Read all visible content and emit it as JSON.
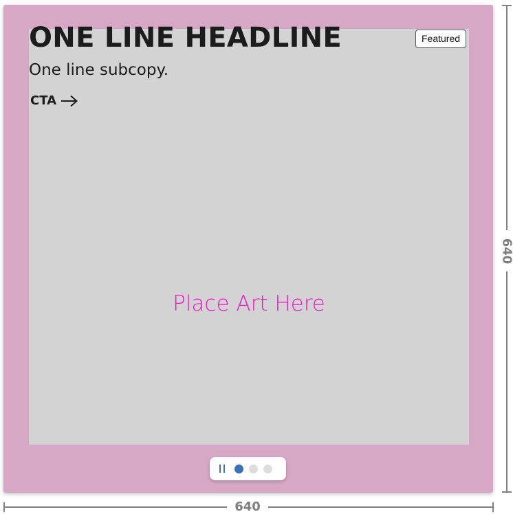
{
  "card": {
    "headline": "ONE LINE HEADLINE",
    "subcopy": "One line subcopy.",
    "cta_label": "CTA",
    "cta_icon": "arrow-right-icon",
    "badge": "Featured",
    "art_placeholder": "Place Art Here",
    "background_color": "#d7a8c6",
    "art_placeholder_color": "#f019c8"
  },
  "pager": {
    "pause_icon": "pause-icon",
    "slides": 3,
    "active_index": 0,
    "accent_color": "#3b6fb6"
  },
  "dimensions": {
    "width_label": "640",
    "height_label": "640"
  }
}
